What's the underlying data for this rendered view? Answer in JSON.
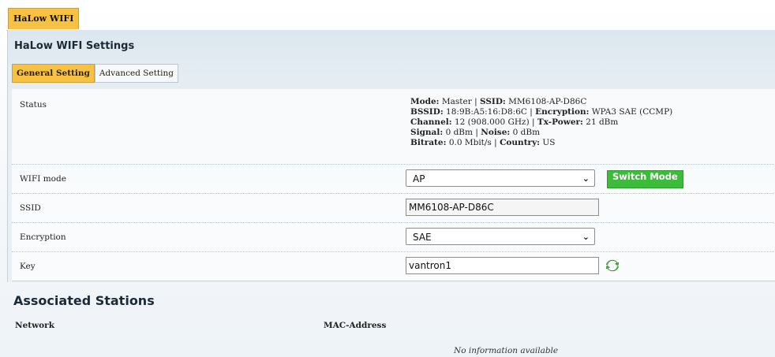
{
  "top_tab": "HaLow WIFI",
  "page_title": "HaLow WIFI Settings",
  "subtabs": [
    "General Setting",
    "Advanced Setting"
  ],
  "status": {
    "label": "Status",
    "mode_label": "Mode:",
    "mode": "Master",
    "ssid_label": "SSID:",
    "ssid": "MM6108-AP-D86C",
    "bssid_label": "BSSID:",
    "bssid": "18:9B:A5:16:D8:6C",
    "encryption_label": "Encryption:",
    "encryption": "WPA3 SAE (CCMP)",
    "channel_label": "Channel:",
    "channel": "12 (908.000 GHz)",
    "txpower_label": "Tx-Power:",
    "txpower": "21 dBm",
    "signal_label": "Signal:",
    "signal": "0 dBm",
    "noise_label": "Noise:",
    "noise": "0 dBm",
    "bitrate_label": "Bitrate:",
    "bitrate": "0.0 Mbit/s",
    "country_label": "Country:",
    "country": "US",
    "sep": "|"
  },
  "wifi_mode": {
    "label": "WIFI mode",
    "value": "AP",
    "button": "Switch Mode"
  },
  "ssid_field": {
    "label": "SSID",
    "value": "MM6108-AP-D86C"
  },
  "encryption_field": {
    "label": "Encryption",
    "value": "SAE"
  },
  "key_field": {
    "label": "Key",
    "value": "vantron1",
    "icon": "refresh-icon"
  },
  "associated": {
    "title": "Associated Stations",
    "columns": [
      "Network",
      "MAC-Address"
    ],
    "empty": "No information available"
  },
  "colors": {
    "active_tab": "#f7c244",
    "switch_button": "#3dbb3a"
  }
}
